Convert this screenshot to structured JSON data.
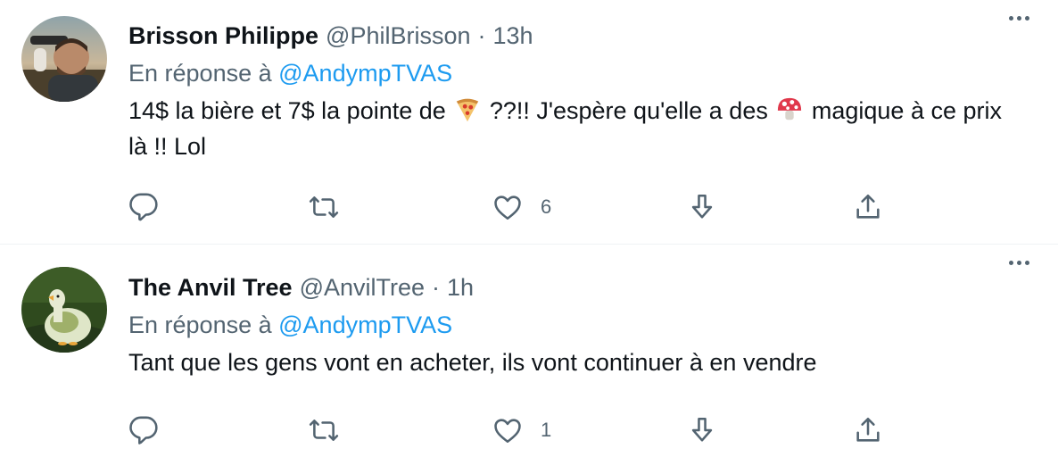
{
  "tweets": [
    {
      "display_name": "Brisson Philippe",
      "handle": "@PhilBrisson",
      "separator": "·",
      "time": "13h",
      "reply_prefix": "En réponse à",
      "reply_to": "@AndympTVAS",
      "text_part1": "14$ la bière et 7$ la pointe de",
      "text_part2": "??!! J'espère qu'elle a des",
      "text_part3": "magique à ce prix là !! Lol",
      "emojis": [
        "pizza-emoji",
        "mushroom-emoji"
      ],
      "like_count": "6",
      "reply_count": "",
      "retweet_count": ""
    },
    {
      "display_name": "The Anvil Tree",
      "handle": "@AnvilTree",
      "separator": "·",
      "time": "1h",
      "reply_prefix": "En réponse à",
      "reply_to": "@AndympTVAS",
      "text": "Tant que les gens vont en acheter, ils vont continuer à en vendre",
      "like_count": "1",
      "reply_count": "",
      "retweet_count": ""
    }
  ],
  "icons": {
    "reply": "reply-icon",
    "retweet": "retweet-icon",
    "like": "like-icon",
    "download": "download-icon",
    "share": "share-icon",
    "more": "more-icon"
  },
  "colors": {
    "text": "#0f1419",
    "secondary": "#536471",
    "link": "#1d9bf0",
    "divider": "#eff3f4"
  }
}
